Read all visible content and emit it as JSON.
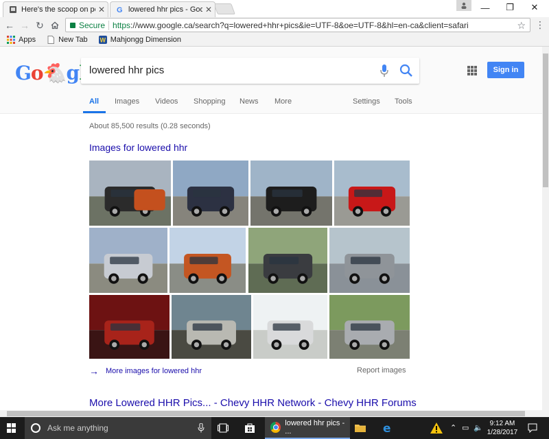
{
  "browser": {
    "tabs": [
      {
        "title": "Here's the scoop on pos",
        "active": false
      },
      {
        "title": "lowered hhr pics - Goog",
        "active": true
      }
    ],
    "url_scheme": "https",
    "url_host_path": "://www.google.ca/search?q=lowered+hhr+pics&ie=UTF-8&oe=UTF-8&hl=en-ca&client=safari",
    "secure_label": "Secure",
    "bookmarks": [
      {
        "label": "Apps",
        "icon": "apps-grid-icon"
      },
      {
        "label": "New Tab",
        "icon": "page-icon"
      },
      {
        "label": "Mahjongg Dimension",
        "icon": "mahjongg-icon"
      }
    ]
  },
  "google": {
    "logo_text": "Google",
    "query": "lowered hhr pics",
    "signin_label": "Sign in",
    "nav": {
      "all": "All",
      "images": "Images",
      "videos": "Videos",
      "shopping": "Shopping",
      "news": "News",
      "more": "More",
      "settings": "Settings",
      "tools": "Tools"
    },
    "results_count": "About 85,500 results (0.28 seconds)",
    "images_heading": "Images for lowered hhr",
    "more_images": "More images for lowered hhr",
    "report_images": "Report images",
    "first_result": "More Lowered HHR Pics... - Chevy HHR Network - Chevy HHR Forums",
    "thumbnails": [
      {
        "car": "#2b2b2b",
        "car2": "#c4501e",
        "sky": "#a9b4c0",
        "ground": "#6c7264"
      },
      {
        "car": "#2c3142",
        "sky": "#8fa8c4",
        "ground": "#86847c"
      },
      {
        "car": "#1d1d1d",
        "sky": "#9fb4c8",
        "ground": "#74746c"
      },
      {
        "car": "#c81818",
        "sky": "#a8bccd",
        "ground": "#9a9a94"
      },
      {
        "car": "#c7cbd2",
        "sky": "#9fb1c9",
        "ground": "#8b8b80"
      },
      {
        "car": "#c45622",
        "sky": "#c2d3e6",
        "ground": "#8a8d86"
      },
      {
        "car": "#3a3c40",
        "sky": "#8fa57a",
        "ground": "#5f6c54"
      },
      {
        "car": "#8f9499",
        "sky": "#b6c4cc",
        "ground": "#8a9198"
      },
      {
        "car": "#a8231a",
        "sky": "#6d1212",
        "ground": "#3a1414"
      },
      {
        "car": "#b9b9b2",
        "sky": "#6f8590",
        "ground": "#4a4a42"
      },
      {
        "car": "#d9dadb",
        "sky": "#eef2f3",
        "ground": "#c9ccc8"
      },
      {
        "car": "#a9acb0",
        "sky": "#7c9a5e",
        "ground": "#7c8073"
      }
    ]
  },
  "taskbar": {
    "search_placeholder": "Ask me anything",
    "chrome_task_label": "lowered hhr pics - ...",
    "time": "9:12 AM",
    "date": "1/28/2017"
  }
}
